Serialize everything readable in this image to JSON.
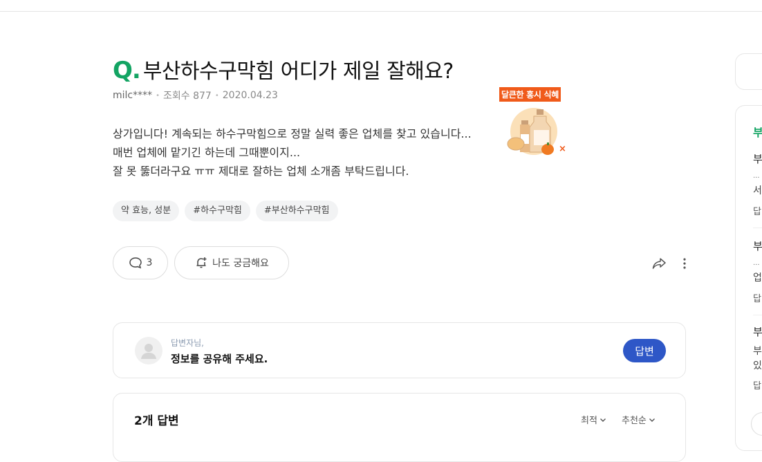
{
  "question": {
    "mark": "Q.",
    "title": "부산하수구막힘 어디가 제일 잘해요?",
    "author": "milc****",
    "views": "조회수 877",
    "date": "2020.04.23",
    "body": [
      "상가입니다! 계속되는 하수구막힘으로 정말 실력 좋은 업체를 찾고 있습니다...",
      "매번 업체에 맡기긴 하는데 그때뿐이지...",
      "잘 못 뚫더라구요 ㅠㅠ 제대로 잘하는 업체 소개좀 부탁드립니다."
    ],
    "tags": [
      "약 효능, 성분",
      "#하수구막힘",
      "#부산하수구막힘"
    ]
  },
  "ad": {
    "label": "달큰한 홍시 식혜",
    "close": "×"
  },
  "actions": {
    "comment_count": "3",
    "curious_label": "나도 궁금해요"
  },
  "answer_prompt": {
    "sub": "답변자님,",
    "main": "정보를 공유해 주세요.",
    "button": "답변"
  },
  "answers": {
    "count_label": "2개 답변",
    "sort_latest": "최적",
    "sort_recommend": "추천순"
  },
  "sidebar": {
    "title": "부",
    "items": [
      {
        "title": "부",
        "dots": "...",
        "line": "서",
        "ans": "답"
      },
      {
        "title": "부",
        "dots": "...",
        "line": "업",
        "ans": "답"
      },
      {
        "title": "부",
        "line": "부",
        "line2": "있",
        "ans": "답"
      }
    ]
  },
  "colors": {
    "brand_green": "#13a463",
    "answer_blue": "#2e57c7",
    "ad_orange": "#f05a1a"
  }
}
